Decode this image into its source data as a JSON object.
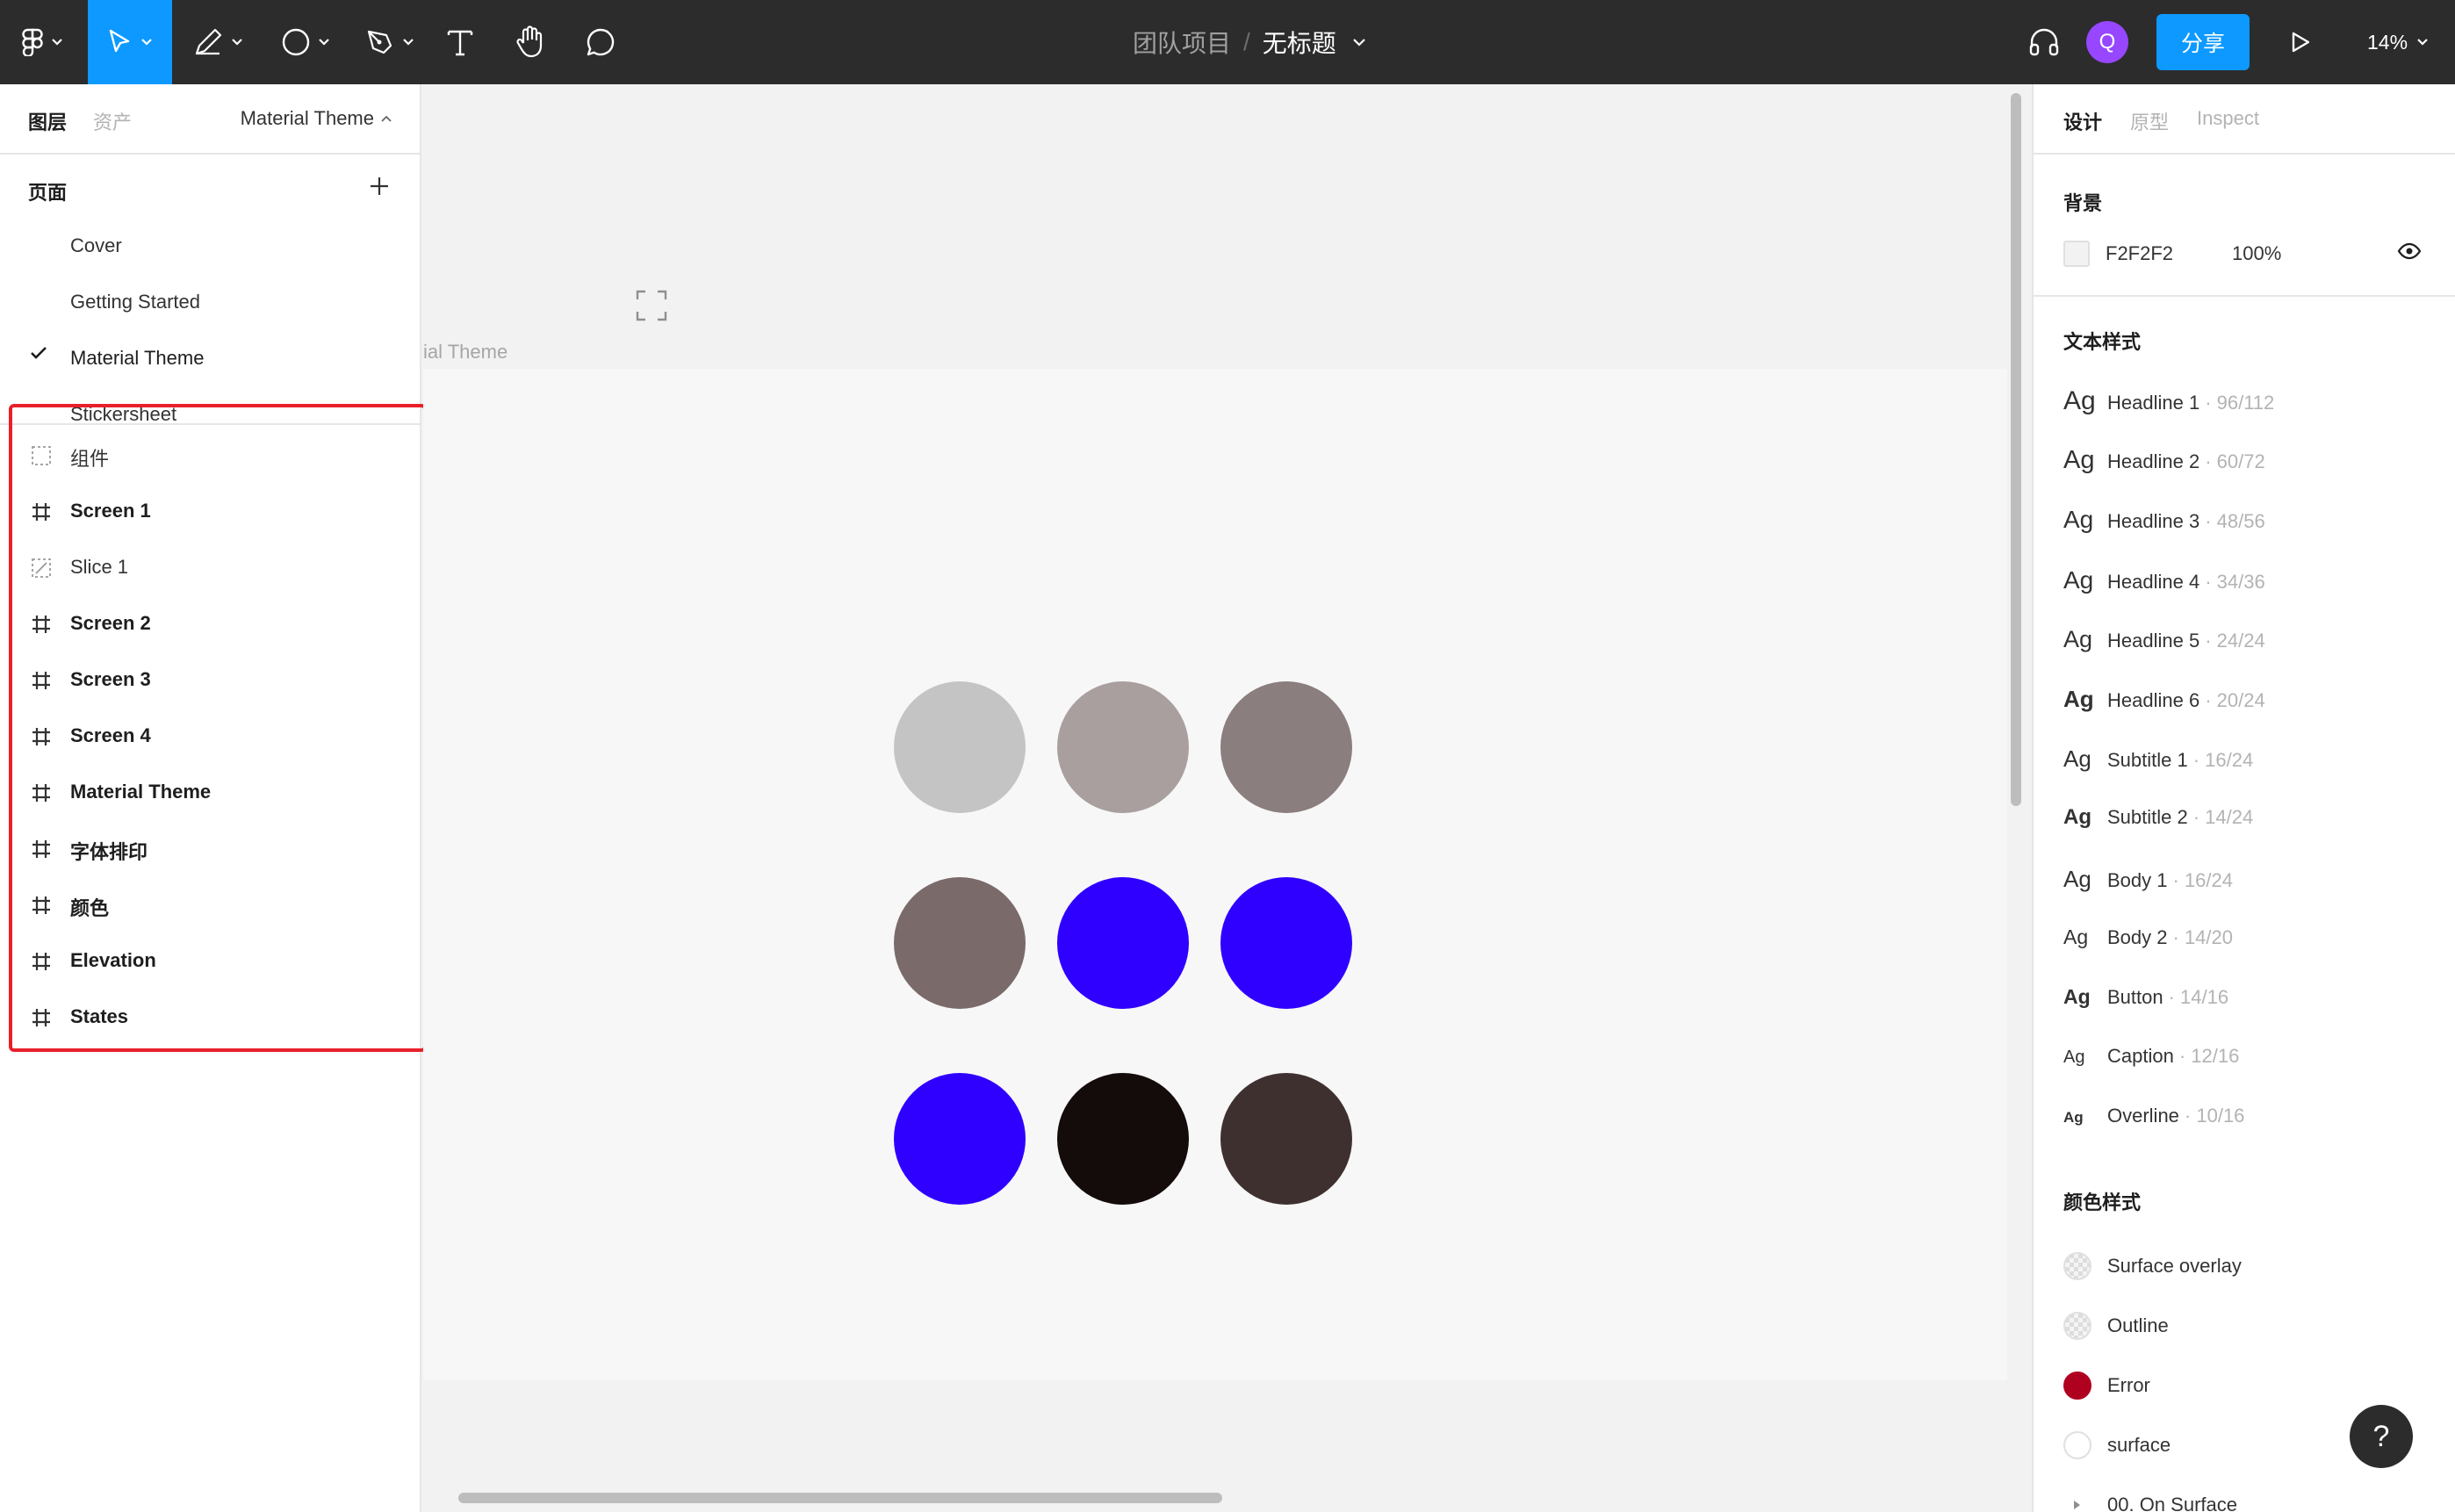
{
  "toolbar": {
    "team": "团队项目",
    "separator": "/",
    "file_name": "无标题",
    "avatar_initial": "Q",
    "share_label": "分享",
    "zoom": "14%",
    "icons": [
      "figma-menu-icon",
      "move-tool-icon",
      "frame-tool-icon",
      "shape-tool-icon",
      "pen-tool-icon",
      "text-tool-icon",
      "hand-tool-icon",
      "comment-tool-icon",
      "audio-icon",
      "present-icon"
    ]
  },
  "left_panel": {
    "tabs": {
      "layers": "图层",
      "assets": "资产"
    },
    "theme_switch": "Material Theme",
    "pages_title": "页面",
    "pages": [
      {
        "label": "Cover",
        "current": false
      },
      {
        "label": "Getting Started",
        "current": false
      },
      {
        "label": "Material Theme",
        "current": true
      },
      {
        "label": "Stickersheet",
        "current": false
      }
    ],
    "layers": [
      {
        "label": "组件",
        "icon": "section-icon",
        "bold": false
      },
      {
        "label": "Screen 1",
        "icon": "frame-icon",
        "bold": true
      },
      {
        "label": "Slice 1",
        "icon": "slice-icon",
        "bold": false
      },
      {
        "label": "Screen 2",
        "icon": "frame-icon",
        "bold": true
      },
      {
        "label": "Screen 3",
        "icon": "frame-icon",
        "bold": true
      },
      {
        "label": "Screen 4",
        "icon": "frame-icon",
        "bold": true
      },
      {
        "label": "Material Theme",
        "icon": "frame-icon",
        "bold": true
      },
      {
        "label": "字体排印",
        "icon": "frame-icon",
        "bold": true
      },
      {
        "label": "颜色",
        "icon": "frame-icon",
        "bold": true
      },
      {
        "label": "Elevation",
        "icon": "frame-icon",
        "bold": true
      },
      {
        "label": "States",
        "icon": "frame-icon",
        "bold": true
      }
    ],
    "highlight_color": "#e8202a"
  },
  "canvas": {
    "frame_label": "ial Theme",
    "swatches": [
      "#c4c4c4",
      "#aa9f9f",
      "#8a7e7e",
      "#7b6a6a",
      "#2f00ff",
      "#2f00ff",
      "#2f00ff",
      "#140b0b",
      "#3f3030"
    ]
  },
  "right_panel": {
    "tabs": {
      "design": "设计",
      "prototype": "原型",
      "inspect": "Inspect"
    },
    "background": {
      "title": "背景",
      "hex": "F2F2F2",
      "opacity": "100%"
    },
    "text_styles_title": "文本样式",
    "text_styles": [
      {
        "name": "Headline 1",
        "spec": "· 96/112",
        "ag_size": 30,
        "ag_weight": "normal"
      },
      {
        "name": "Headline 2",
        "spec": "· 60/72",
        "ag_size": 29,
        "ag_weight": "normal"
      },
      {
        "name": "Headline 3",
        "spec": "· 48/56",
        "ag_size": 28,
        "ag_weight": "normal"
      },
      {
        "name": "Headline 4",
        "spec": "· 34/36",
        "ag_size": 28,
        "ag_weight": "normal"
      },
      {
        "name": "Headline 5",
        "spec": "· 24/24",
        "ag_size": 27,
        "ag_weight": "normal"
      },
      {
        "name": "Headline 6",
        "spec": "· 20/24",
        "ag_size": 26,
        "ag_weight": "bold"
      },
      {
        "name": "Subtitle 1",
        "spec": "· 16/24",
        "ag_size": 26,
        "ag_weight": "normal"
      },
      {
        "name": "Subtitle 2",
        "spec": "· 14/24",
        "ag_size": 24,
        "ag_weight": "bold"
      },
      {
        "name": "Body 1",
        "spec": "· 16/24",
        "ag_size": 26,
        "ag_weight": "normal"
      },
      {
        "name": "Body 2",
        "spec": "· 14/20",
        "ag_size": 23,
        "ag_weight": "normal"
      },
      {
        "name": "Button",
        "spec": "· 14/16",
        "ag_size": 23,
        "ag_weight": "bold"
      },
      {
        "name": "Caption",
        "spec": "· 12/16",
        "ag_size": 20,
        "ag_weight": "normal"
      },
      {
        "name": "Overline",
        "spec": "· 10/16",
        "ag_size": 17,
        "ag_weight": "bold"
      }
    ],
    "color_styles_title": "颜色样式",
    "color_styles": [
      {
        "name": "Surface overlay",
        "swatch": "checker"
      },
      {
        "name": "Outline",
        "swatch": "checker"
      },
      {
        "name": "Error",
        "swatch": "#b00020"
      },
      {
        "name": "surface",
        "swatch": "#ffffff"
      },
      {
        "name": "00. On Surface",
        "swatch": "group"
      }
    ]
  },
  "help_label": "?"
}
